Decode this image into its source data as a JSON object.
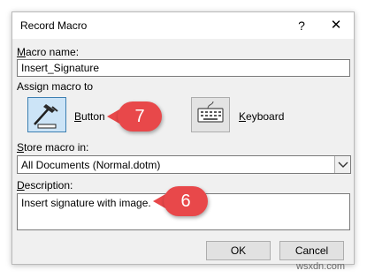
{
  "dialog": {
    "title": "Record Macro",
    "help_glyph": "?",
    "close_glyph": "✕"
  },
  "macro_name": {
    "label_first": "M",
    "label_rest": "acro name:",
    "value": "Insert_Signature"
  },
  "assign": {
    "label": "Assign macro to",
    "button_label_first": "B",
    "button_label_rest": "utton",
    "keyboard_label_first": "K",
    "keyboard_label_rest": "eyboard"
  },
  "store": {
    "label_first": "S",
    "label_rest": "tore macro in:",
    "selected": "All Documents (Normal.dotm)"
  },
  "description": {
    "label_first": "D",
    "label_rest": "escription:",
    "value": "Insert signature with image."
  },
  "buttons": {
    "ok": "OK",
    "cancel": "Cancel"
  },
  "callouts": {
    "button_step": "7",
    "description_step": "6",
    "color": "#e8484a"
  },
  "watermark": "wsxdn.com"
}
